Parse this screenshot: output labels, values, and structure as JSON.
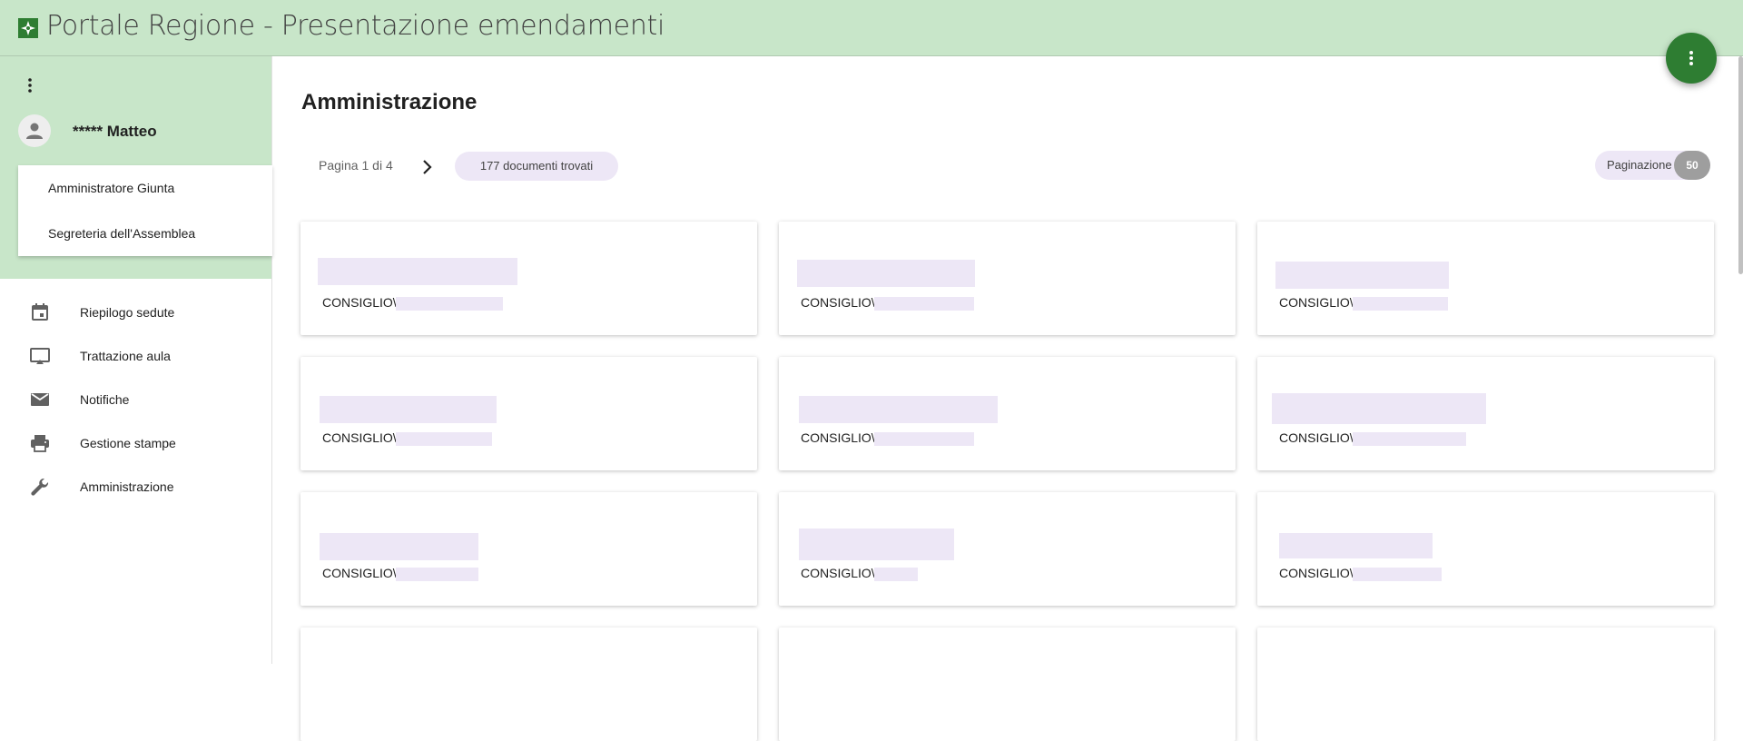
{
  "header": {
    "title": "Portale Regione - Presentazione emendamenti",
    "brand_color": "#2e7d32",
    "header_bg": "#c8e6c9"
  },
  "fab": {
    "icon": "more-vert-icon"
  },
  "sidebar": {
    "menu_icon": "more-vert-icon",
    "user_name": "***** Matteo",
    "roles": [
      "Amministratore Giunta",
      "Segreteria dell'Assemblea"
    ],
    "nav": [
      {
        "label": "Riepilogo sedute",
        "icon": "calendar-icon"
      },
      {
        "label": "Trattazione aula",
        "icon": "cast-icon"
      },
      {
        "label": "Notifiche",
        "icon": "mail-icon"
      },
      {
        "label": "Gestione stampe",
        "icon": "print-icon"
      },
      {
        "label": "Amministrazione",
        "icon": "wrench-icon"
      }
    ]
  },
  "main": {
    "title": "Amministrazione",
    "pager": "Pagina 1 di 4",
    "documents_found": "177 documenti trovati",
    "pagination_label": "Paginazione",
    "pagination_value": "50"
  },
  "cards": [
    {
      "path": "CONSIGLIO\\"
    },
    {
      "path": "CONSIGLIO\\"
    },
    {
      "path": "CONSIGLIO\\"
    },
    {
      "path": "CONSIGLIO\\"
    },
    {
      "path": "CONSIGLIO\\"
    },
    {
      "path": "CONSIGLIO\\"
    },
    {
      "path": "CONSIGLIO\\"
    },
    {
      "path": "CONSIGLIO\\"
    },
    {
      "path": "CONSIGLIO\\"
    }
  ]
}
